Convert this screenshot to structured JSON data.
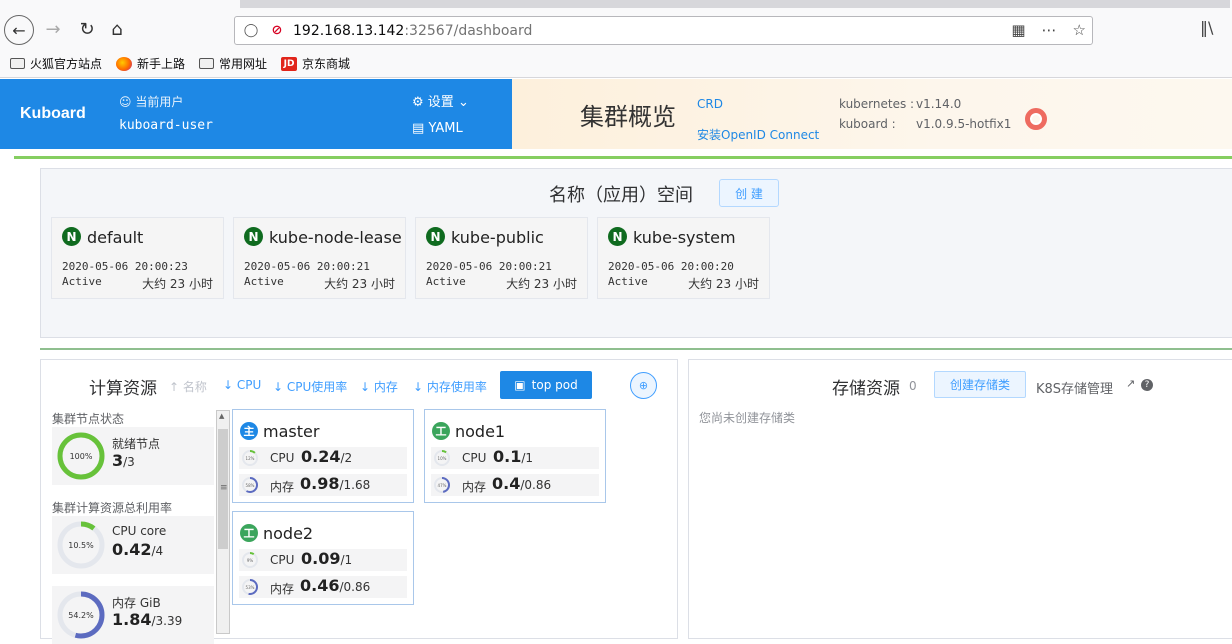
{
  "browser": {
    "url_host": "192.168.13.142",
    "url_path": ":32567/dashboard",
    "bookmarks": [
      "火狐官方站点",
      "新手上路",
      "常用网址",
      "京东商城"
    ]
  },
  "header": {
    "brand": "Kuboard",
    "user_label": "当前用户",
    "user_name": "kuboard-user",
    "settings_label": "设置",
    "yaml_label": "YAML",
    "page_title": "集群概览",
    "crd_link": "CRD",
    "openid_link": "安装OpenID Connect",
    "versions": [
      {
        "label": "kubernetes :",
        "value": "v1.14.0"
      },
      {
        "label": "kuboard    :",
        "value": "v1.0.9.5-hotfix1"
      }
    ]
  },
  "namespaces": {
    "title": "名称（应用）空间",
    "create_label": "创 建",
    "items": [
      {
        "badge": "N",
        "name": "default",
        "created": "2020-05-06 20:00:23",
        "status": "Active",
        "age": "大约 23 小时"
      },
      {
        "badge": "N",
        "name": "kube-node-lease",
        "created": "2020-05-06 20:00:21",
        "status": "Active",
        "age": "大约 23 小时"
      },
      {
        "badge": "N",
        "name": "kube-public",
        "created": "2020-05-06 20:00:21",
        "status": "Active",
        "age": "大约 23 小时"
      },
      {
        "badge": "N",
        "name": "kube-system",
        "created": "2020-05-06 20:00:20",
        "status": "Active",
        "age": "大约 23 小时"
      }
    ]
  },
  "compute": {
    "title": "计算资源",
    "sort_options": [
      "名称",
      "CPU",
      "CPU使用率",
      "内存",
      "内存使用率"
    ],
    "top_pod_label": "top pod",
    "node_status_heading": "集群节点状态",
    "usage_heading": "集群计算资源总利用率",
    "summary": [
      {
        "label": "就绪节点",
        "value": "3",
        "total": "/3",
        "percent_label": "100%",
        "fraction": 1.0,
        "color": "#67c23a"
      },
      {
        "label": "CPU core",
        "value": "0.42",
        "total": "/4",
        "percent_label": "10.5%",
        "fraction": 0.105,
        "color": "#67c23a"
      },
      {
        "label": "内存 GiB",
        "value": "1.84",
        "total": "/3.39",
        "percent_label": "54.2%",
        "fraction": 0.542,
        "color": "#5c6bc0"
      }
    ],
    "nodes": [
      {
        "badge": "主",
        "badge_color": "#1e88e5",
        "name": "master",
        "cpu": {
          "label": "CPU",
          "value": "0.24",
          "total": "/2",
          "ring_label": "12%",
          "fraction": 0.12
        },
        "mem": {
          "label": "内存",
          "value": "0.98",
          "total": "/1.68",
          "ring_label": "58%",
          "fraction": 0.58
        }
      },
      {
        "badge": "工",
        "badge_color": "#3ba55c",
        "name": "node1",
        "cpu": {
          "label": "CPU",
          "value": "0.1",
          "total": "/1",
          "ring_label": "10%",
          "fraction": 0.1
        },
        "mem": {
          "label": "内存",
          "value": "0.4",
          "total": "/0.86",
          "ring_label": "47%",
          "fraction": 0.47
        }
      },
      {
        "badge": "工",
        "badge_color": "#3ba55c",
        "name": "node2",
        "cpu": {
          "label": "CPU",
          "value": "0.09",
          "total": "/1",
          "ring_label": "9%",
          "fraction": 0.09
        },
        "mem": {
          "label": "内存",
          "value": "0.46",
          "total": "/0.86",
          "ring_label": "53%",
          "fraction": 0.53
        }
      }
    ]
  },
  "storage": {
    "title": "存储资源",
    "count": "0",
    "create_label": "创建存储类",
    "manage_link": "K8S存储管理",
    "empty_text": "您尚未创建存储类"
  }
}
